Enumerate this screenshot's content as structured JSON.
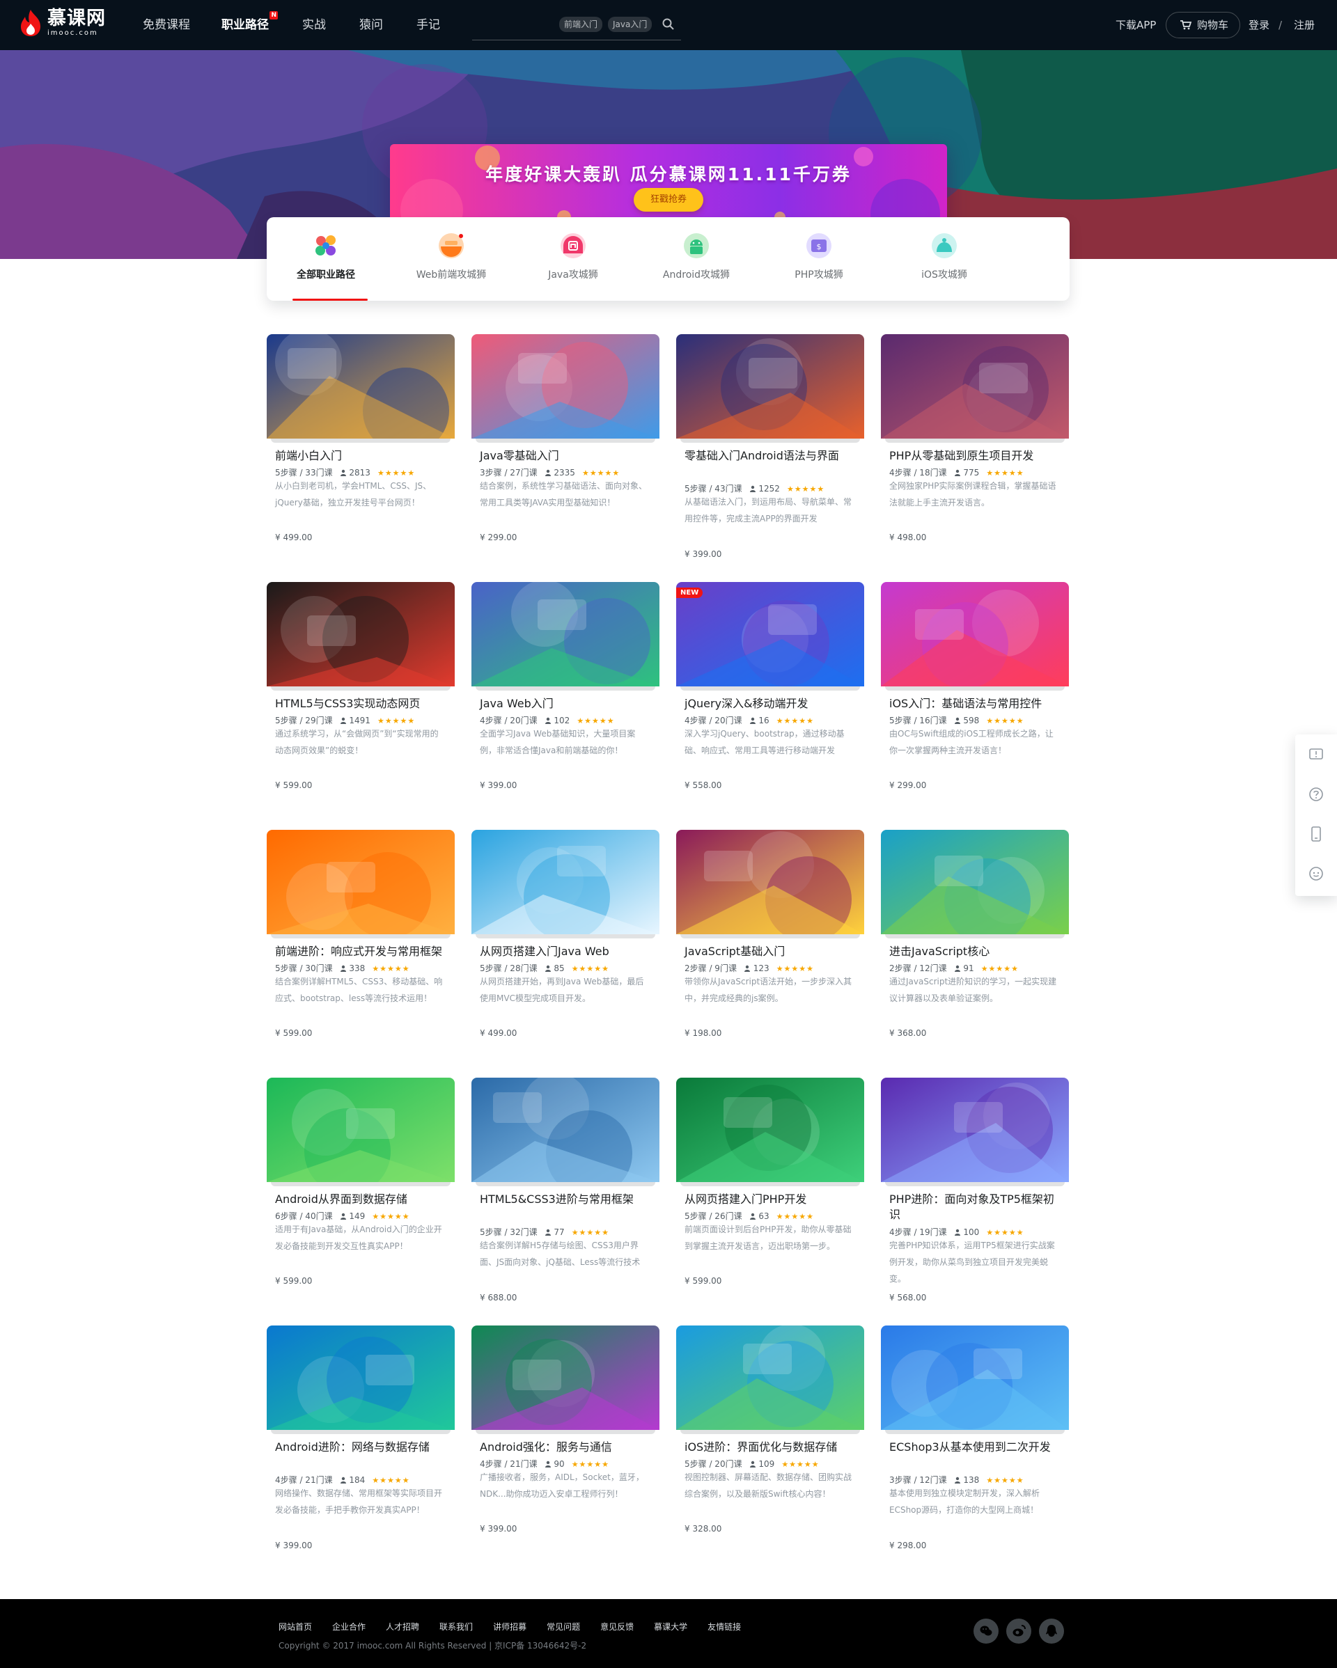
{
  "header": {
    "logo": {
      "cn": "慕课网",
      "en": "imooc.com"
    },
    "nav": [
      {
        "label": "免费课程",
        "active": false
      },
      {
        "label": "职业路径",
        "active": true,
        "badge": "N"
      },
      {
        "label": "实战",
        "active": false
      },
      {
        "label": "猿问",
        "active": false
      },
      {
        "label": "手记",
        "active": false
      }
    ],
    "search": {
      "tags": [
        "前端入门",
        "Java入门"
      ],
      "icon": "search-icon"
    },
    "download": "下载APP",
    "cart": "购物车",
    "login": "登录",
    "sep": "/",
    "register": "注册"
  },
  "banner": {
    "title": "年度好课大轰趴  瓜分慕课网11.11千万券",
    "button": "狂戳抢券"
  },
  "tabs": [
    {
      "label": "全部职业路径",
      "active": true,
      "icon": "all-paths-icon"
    },
    {
      "label": "Web前端攻城狮",
      "active": false,
      "icon": "web-icon"
    },
    {
      "label": "Java攻城狮",
      "active": false,
      "icon": "java-icon"
    },
    {
      "label": "Android攻城狮",
      "active": false,
      "icon": "android-icon"
    },
    {
      "label": "PHP攻城狮",
      "active": false,
      "icon": "php-icon"
    },
    {
      "label": "iOS攻城狮",
      "active": false,
      "icon": "ios-icon"
    }
  ],
  "courses": [
    {
      "title": "前端小白入门",
      "steps": "5步骤 / 33门课",
      "students": "2813",
      "rating": "★★★★★",
      "desc": "从小白到老司机，学会HTML、CSS、JS、jQuery基础，独立开发挂号平台网页！",
      "price": "¥ 499.00",
      "colors": [
        "#1b3a8c",
        "#e8a93c"
      ]
    },
    {
      "title": "Java零基础入门",
      "steps": "3步骤 / 27门课",
      "students": "2335",
      "rating": "★★★★★",
      "desc": "结合案例，系统性学习基础语法、面向对象、常用工具类等JAVA实用型基础知识！",
      "price": "¥ 299.00",
      "colors": [
        "#ef5a78",
        "#3f9be8"
      ]
    },
    {
      "title": "零基础入门Android语法与界面",
      "steps": "5步骤 / 43门课",
      "students": "1252",
      "rating": "★★★★★",
      "desc": "从基础语法入门，到运用布局、导航菜单、常用控件等，完成主流APP的界面开发",
      "price": "¥ 399.00",
      "colors": [
        "#2a2f7a",
        "#e8612c"
      ]
    },
    {
      "title": "PHP从零基础到原生项目开发",
      "steps": "4步骤 / 18门课",
      "students": "775",
      "rating": "★★★★★",
      "desc": "全网独家PHP实际案例课程合辑，掌握基础语法就能上手主流开发语言。",
      "price": "¥ 498.00",
      "colors": [
        "#5a2a6e",
        "#c25a6a"
      ]
    },
    {
      "title": "HTML5与CSS3实现动态网页",
      "steps": "5步骤 / 29门课",
      "students": "1491",
      "rating": "★★★★★",
      "desc": "通过系统学习，从“会做网页”到“实现常用的动态网页效果”的蜕变！",
      "price": "¥ 599.00",
      "colors": [
        "#1a1a1a",
        "#e23b2e"
      ]
    },
    {
      "title": "Java Web入门",
      "steps": "4步骤 / 20门课",
      "students": "102",
      "rating": "★★★★★",
      "desc": "全面学习Java Web基础知识，大量项目案例，非常适合懂Java和前端基础的你！",
      "price": "¥ 399.00",
      "colors": [
        "#4a62c8",
        "#2ec27e"
      ]
    },
    {
      "title": "jQuery深入&移动端开发",
      "steps": "4步骤 / 20门课",
      "students": "16",
      "rating": "★★★★★",
      "desc": "深入学习jQuery、bootstrap，通过移动基础、响应式、常用工具等进行移动端开发",
      "price": "¥ 558.00",
      "colors": [
        "#6a3fc8",
        "#1d6ff0"
      ],
      "badge": "NEW"
    },
    {
      "title": "iOS入门：基础语法与常用控件",
      "steps": "5步骤 / 16门课",
      "students": "598",
      "rating": "★★★★★",
      "desc": "由OC与Swift组成的iOS工程师成长之路，让你一次掌握两种主流开发语言！",
      "price": "¥ 299.00",
      "colors": [
        "#c43ad0",
        "#ff3d5a"
      ]
    },
    {
      "title": "前端进阶：响应式开发与常用框架",
      "steps": "5步骤 / 30门课",
      "students": "338",
      "rating": "★★★★★",
      "desc": "结合案例详解HTML5、CSS3、移动基础、响应式、bootstrap、less等流行技术运用！",
      "price": "¥ 599.00",
      "colors": [
        "#ff6a00",
        "#ffb040"
      ]
    },
    {
      "title": "从网页搭建入门Java Web",
      "steps": "5步骤 / 28门课",
      "students": "85",
      "rating": "★★★★★",
      "desc": "从网页搭建开始，再到Java Web基础，最后使用MVC模型完成项目开发。",
      "price": "¥ 499.00",
      "colors": [
        "#2aa3e0",
        "#e8f6ff"
      ]
    },
    {
      "title": "JavaScript基础入门",
      "steps": "2步骤 / 9门课",
      "students": "123",
      "rating": "★★★★★",
      "desc": "带领你从JavaScript语法开始，一步步深入其中，并完成经典的js案例。",
      "price": "¥ 198.00",
      "colors": [
        "#8a1a5a",
        "#ffd23c"
      ]
    },
    {
      "title": "进击JavaScript核心",
      "steps": "2步骤 / 12门课",
      "students": "91",
      "rating": "★★★★★",
      "desc": "通过JavaScript进阶知识的学习，一起实现建议计算器以及表单验证案例。",
      "price": "¥ 368.00",
      "colors": [
        "#1aa0c8",
        "#7ad04a"
      ]
    },
    {
      "title": "Android从界面到数据存储",
      "steps": "6步骤 / 40门课",
      "students": "149",
      "rating": "★★★★★",
      "desc": "适用于有Java基础，从Android入门的企业开发必备技能到开发交互性真实APP！",
      "price": "¥ 599.00",
      "colors": [
        "#1cb858",
        "#7ee06a"
      ]
    },
    {
      "title": "HTML5&CSS3进阶与常用框架",
      "steps": "5步骤 / 32门课",
      "students": "77",
      "rating": "★★★★★",
      "desc": "结合案例详解H5存储与绘图、CSS3用户界面、JS面向对象、jQ基础、Less等流行技术",
      "price": "¥ 688.00",
      "colors": [
        "#2b6aa8",
        "#8ec8f0"
      ]
    },
    {
      "title": "从网页搭建入门PHP开发",
      "steps": "5步骤 / 26门课",
      "students": "63",
      "rating": "★★★★★",
      "desc": "前端页面设计到后台PHP开发，助你从零基础到掌握主流开发语言，迈出职场第一步。",
      "price": "¥ 599.00",
      "colors": [
        "#0a7a3a",
        "#3ed07a"
      ]
    },
    {
      "title": "PHP进阶：面向对象及TP5框架初识",
      "steps": "4步骤 / 19门课",
      "students": "100",
      "rating": "★★★★★",
      "desc": "完善PHP知识体系，运用TP5框架进行实战案例开发，助你从菜鸟到独立项目开发完美蜕变。",
      "price": "¥ 568.00",
      "colors": [
        "#5a2ab0",
        "#8aa8ff"
      ]
    },
    {
      "title": "Android进阶：网络与数据存储",
      "steps": "4步骤 / 21门课",
      "students": "184",
      "rating": "★★★★★",
      "desc": "网络操作、数据存储、常用框架等实际项目开发必备技能，手把手教你开发真实APP！",
      "price": "¥ 399.00",
      "colors": [
        "#0a78d0",
        "#20c89a"
      ]
    },
    {
      "title": "Android强化：服务与通信",
      "steps": "4步骤 / 21门课",
      "students": "90",
      "rating": "★★★★★",
      "desc": "广播接收者，服务，AIDL，Socket，蓝牙，NDK...助你成功迈入安卓工程师行列！",
      "price": "¥ 399.00",
      "colors": [
        "#0e8a52",
        "#b43ad0"
      ]
    },
    {
      "title": "iOS进阶：界面优化与数据存储",
      "steps": "5步骤 / 20门课",
      "students": "109",
      "rating": "★★★★★",
      "desc": "视图控制器、屏幕适配、数据存储、团购实战综合案例，以及最新版Swift核心内容！",
      "price": "¥ 328.00",
      "colors": [
        "#1a9be0",
        "#5cd06a"
      ]
    },
    {
      "title": "ECShop3从基本使用到二次开发",
      "steps": "3步骤 / 12门课",
      "students": "138",
      "rating": "★★★★★",
      "desc": "基本使用到独立模块定制开发，深入解析ECShop源码，打造你的大型网上商城！",
      "price": "¥ 298.00",
      "colors": [
        "#2a7ae8",
        "#5fc0f5"
      ]
    }
  ],
  "side_tools": [
    "feedback-icon",
    "help-icon",
    "app-icon",
    "chat-icon"
  ],
  "footer": {
    "links": [
      "网站首页",
      "企业合作",
      "人才招聘",
      "联系我们",
      "讲师招募",
      "常见问题",
      "意见反馈",
      "慕课大学",
      "友情链接"
    ],
    "copyright": "Copyright © 2017 imooc.com All Rights Reserved | 京ICP备 13046642号-2",
    "social": [
      "wechat-icon",
      "weibo-icon",
      "qq-icon"
    ]
  }
}
